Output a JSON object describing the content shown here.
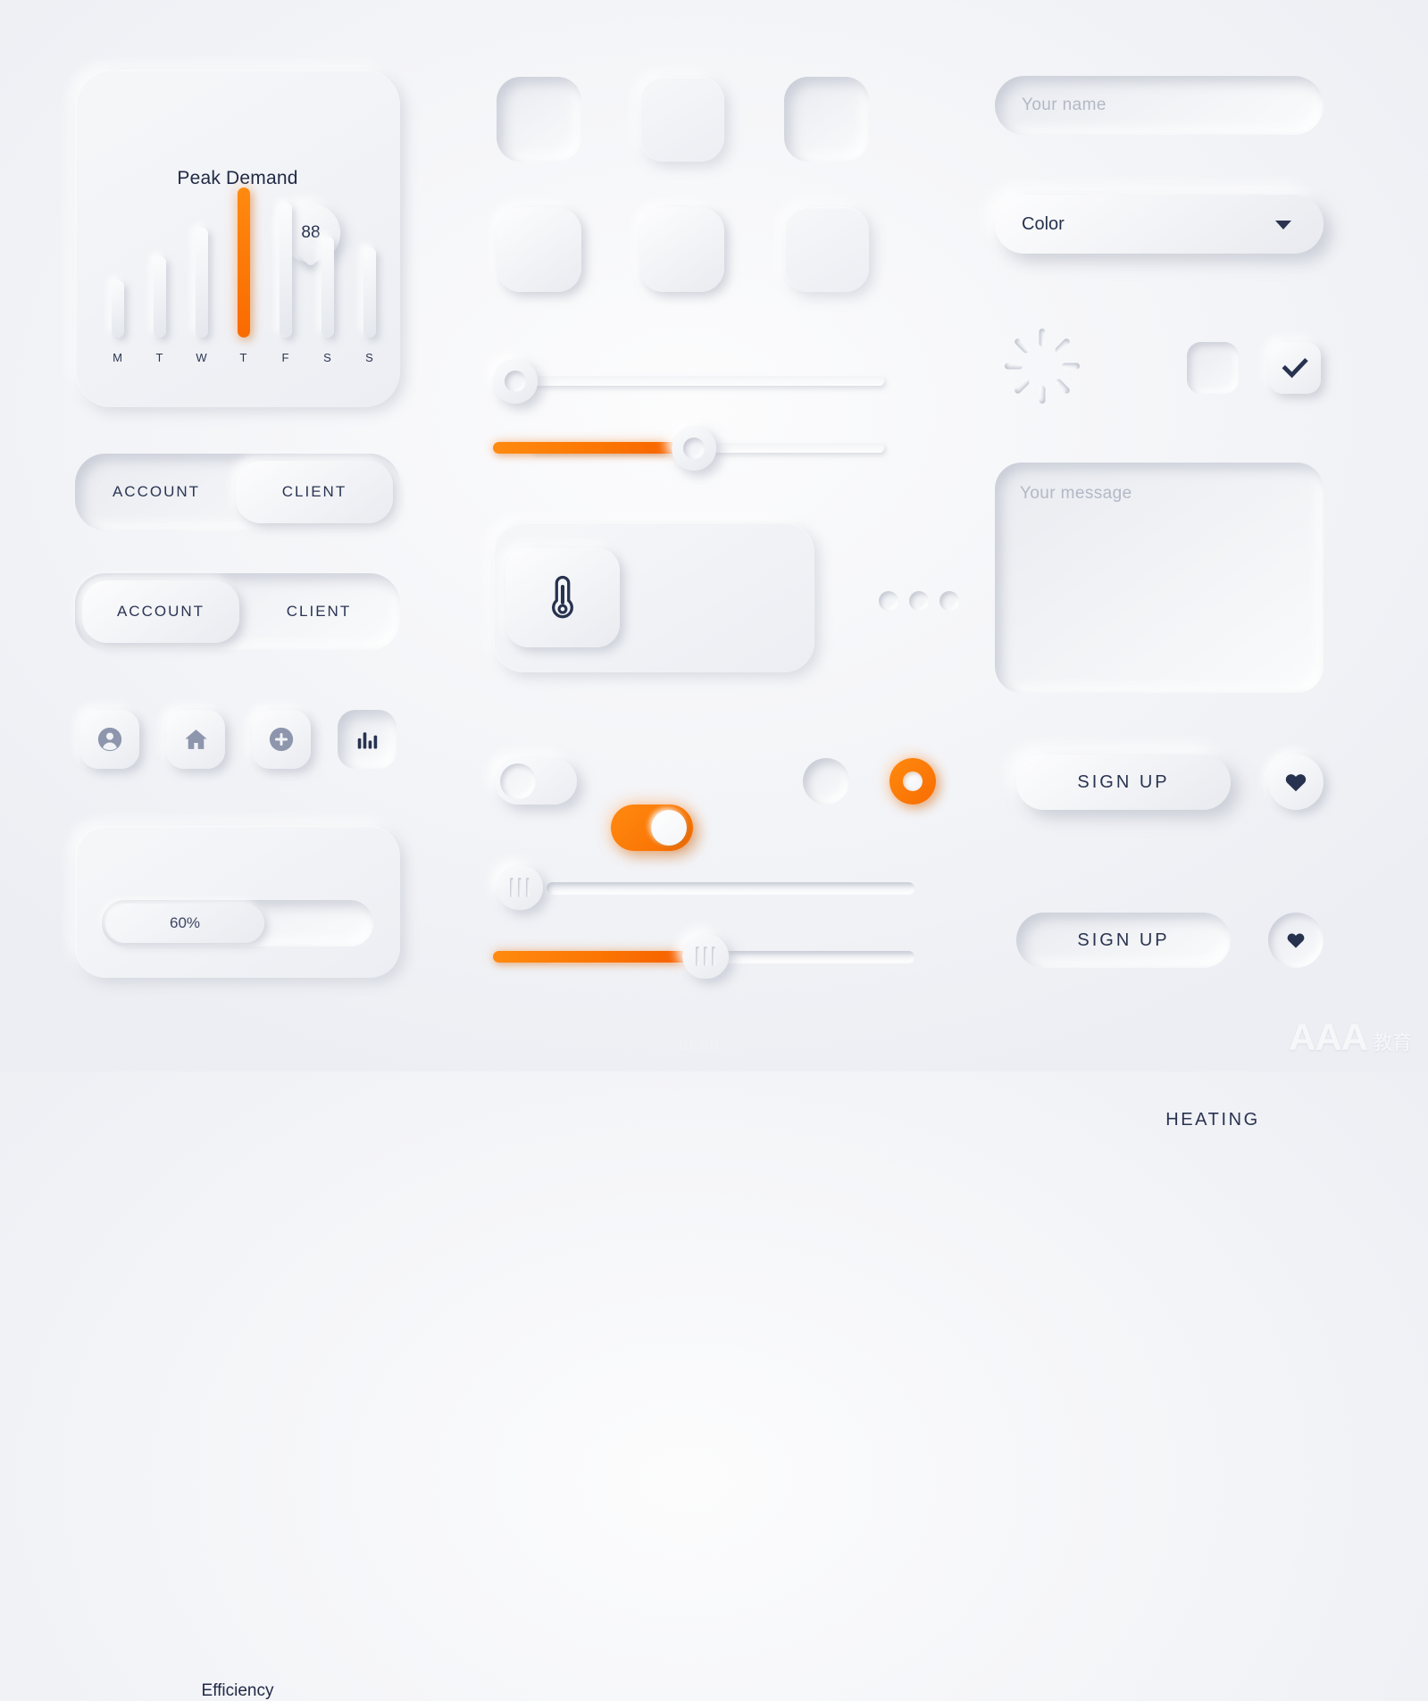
{
  "theme": {
    "accent": "#f96a00",
    "accent_light": "#ff8a10",
    "ink": "#27324f",
    "placeholder": "#b3b8c6",
    "surface": "#f1f3f7"
  },
  "peak_demand": {
    "title": "Peak Demand",
    "value": "88"
  },
  "chart_data": {
    "type": "bar",
    "title": "Peak Demand",
    "categories": [
      "M",
      "T",
      "W",
      "T",
      "F",
      "S",
      "S"
    ],
    "values": [
      38,
      54,
      73,
      100,
      90,
      67,
      60
    ],
    "highlight_index": 3,
    "highlight_value_label": "88",
    "xlabel": "",
    "ylabel": "",
    "ylim": [
      0,
      100
    ],
    "grid": false,
    "legend": false,
    "bar_color": "#e8eaef",
    "highlight_color": "#f96a00"
  },
  "segmented_top": {
    "left_label": "ACCOUNT",
    "right_label": "CLIENT",
    "selected": "CLIENT"
  },
  "segmented_bottom": {
    "left_label": "ACCOUNT",
    "right_label": "CLIENT",
    "selected": "ACCOUNT"
  },
  "icon_buttons": [
    {
      "name": "user-icon",
      "state": "raised"
    },
    {
      "name": "home-icon",
      "state": "raised"
    },
    {
      "name": "plus-circle-icon",
      "state": "raised"
    },
    {
      "name": "bar-chart-icon",
      "state": "pressed"
    }
  ],
  "efficiency": {
    "title": "Efficiency",
    "value_label": "60%",
    "percent": 60
  },
  "cards": {
    "row1": [
      "inset",
      "flat",
      "inset-deep"
    ],
    "row2": [
      "raised",
      "raised",
      "flat"
    ]
  },
  "sliders": [
    {
      "name": "slider-ring-empty",
      "percent": 0,
      "handle": "ring",
      "filled": false
    },
    {
      "name": "slider-ring-half",
      "percent": 50,
      "handle": "ring",
      "filled": true
    },
    {
      "name": "slider-grip-empty",
      "percent": 0,
      "handle": "grip",
      "filled": false
    },
    {
      "name": "slider-grip-half",
      "percent": 50,
      "handle": "grip",
      "filled": true
    }
  ],
  "heating": {
    "label": "HEATING",
    "icon": "thermometer-icon"
  },
  "dots": {
    "count": 3
  },
  "toggles": [
    {
      "name": "toggle-off",
      "on": false
    },
    {
      "name": "toggle-on",
      "on": true
    },
    {
      "name": "radio-off",
      "on": false
    },
    {
      "name": "radio-on",
      "on": true
    }
  ],
  "form": {
    "name_placeholder": "Your name",
    "name_value": "",
    "select_label": "Color",
    "select_options": [
      "Color"
    ],
    "message_placeholder": "Your message",
    "message_value": ""
  },
  "spinner": {
    "name": "loading-spinner-icon",
    "spokes": 8
  },
  "checkboxes": [
    {
      "name": "checkbox-unchecked",
      "checked": false
    },
    {
      "name": "checkbox-checked",
      "checked": true
    }
  ],
  "buttons": {
    "signup_raised": "SIGN UP",
    "signup_pressed": "SIGN UP",
    "heart_icon": "heart-icon"
  },
  "watermark": {
    "brand": "AAA",
    "suffix": "教育",
    "center": "ui-cn"
  }
}
